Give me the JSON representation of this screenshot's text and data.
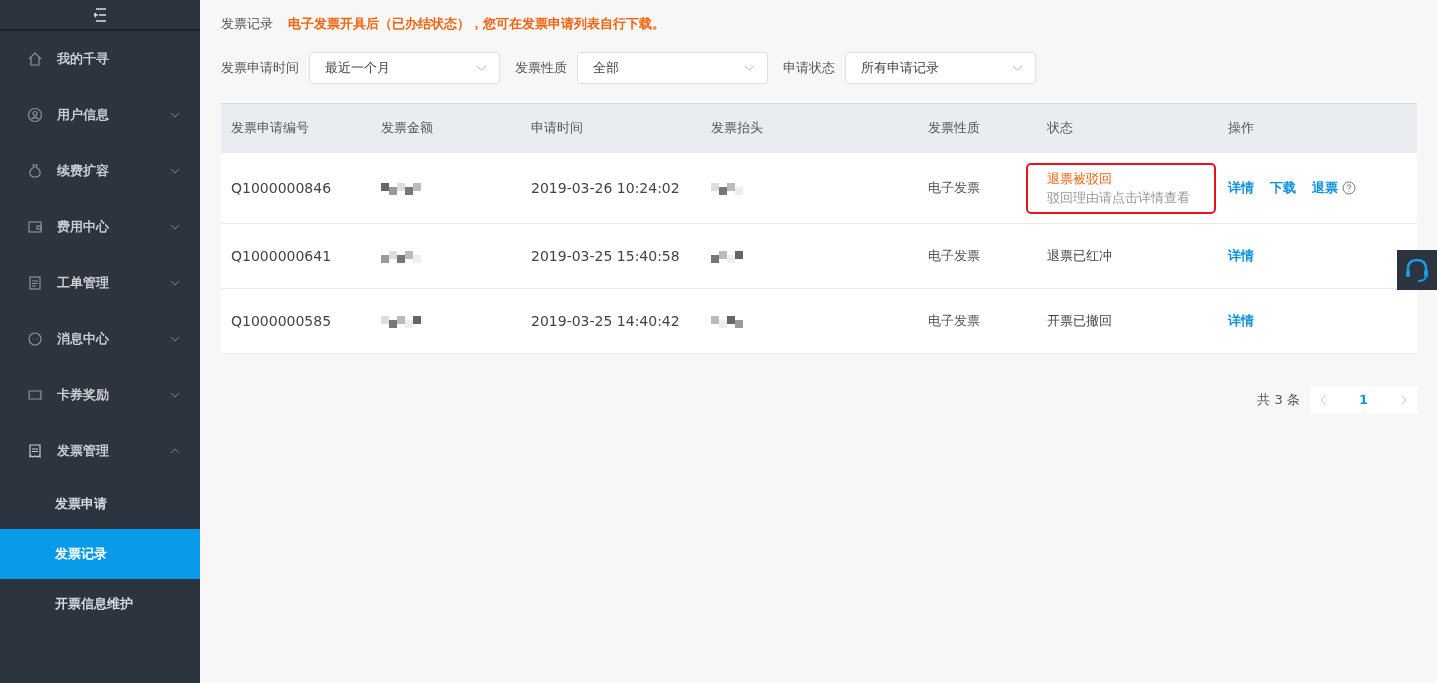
{
  "sidebar": {
    "items": [
      {
        "label": "我的千寻"
      },
      {
        "label": "用户信息",
        "expanded": false
      },
      {
        "label": "续费扩容",
        "expanded": false
      },
      {
        "label": "费用中心",
        "expanded": false
      },
      {
        "label": "工单管理",
        "expanded": false
      },
      {
        "label": "消息中心",
        "expanded": false
      },
      {
        "label": "卡券奖励",
        "expanded": false
      },
      {
        "label": "发票管理",
        "expanded": true,
        "children": [
          {
            "label": "发票申请",
            "selected": false
          },
          {
            "label": "发票记录",
            "selected": true
          },
          {
            "label": "开票信息维护",
            "selected": false
          }
        ]
      }
    ]
  },
  "page": {
    "title": "发票记录",
    "notice": "电子发票开具后（已办结状态），您可在发票申请列表自行下载。"
  },
  "filters": [
    {
      "label": "发票申请时间",
      "value": "最近一个月"
    },
    {
      "label": "发票性质",
      "value": "全部"
    },
    {
      "label": "申请状态",
      "value": "所有申请记录"
    }
  ],
  "table": {
    "columns": [
      "发票申请编号",
      "发票金额",
      "申请时间",
      "发票抬头",
      "发票性质",
      "状态",
      "操作"
    ],
    "rows": [
      {
        "id": "Q1000000846",
        "time": "2019-03-26 10:24:02",
        "type": "电子发票",
        "status": "退票被驳回",
        "status_note": "驳回理由请点击详情查看",
        "highlighted": true,
        "actions": [
          {
            "label": "详情",
            "help": false
          },
          {
            "label": "下载",
            "help": false
          },
          {
            "label": "退票",
            "help": true
          }
        ]
      },
      {
        "id": "Q1000000641",
        "time": "2019-03-25 15:40:58",
        "type": "电子发票",
        "status": "退票已红冲",
        "highlighted": false,
        "actions": [
          {
            "label": "详情",
            "help": false
          }
        ]
      },
      {
        "id": "Q1000000585",
        "time": "2019-03-25 14:40:42",
        "type": "电子发票",
        "status": "开票已撤回",
        "highlighted": false,
        "actions": [
          {
            "label": "详情",
            "help": false
          }
        ]
      }
    ]
  },
  "pagination": {
    "total": "共 3 条",
    "pages": [
      {
        "label": "1",
        "selected": true
      }
    ]
  }
}
